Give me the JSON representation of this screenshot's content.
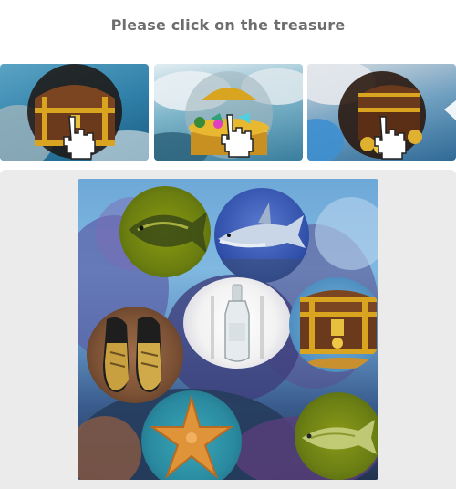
{
  "prompt": "Please click on the treasure",
  "examples": [
    {
      "subject": "treasure chest",
      "icon": "hand-pointer-icon"
    },
    {
      "subject": "treasure chest with gems",
      "icon": "hand-pointer-icon"
    },
    {
      "subject": "treasure chest with gold coins",
      "icon": "hand-pointer-icon"
    }
  ],
  "objects": [
    {
      "name": "fish-object",
      "subject": "green fish"
    },
    {
      "name": "shark-object",
      "subject": "shark"
    },
    {
      "name": "bottle-object",
      "subject": "glass bottle"
    },
    {
      "name": "treasure-chest-object",
      "subject": "treasure chest"
    },
    {
      "name": "shoes-object",
      "subject": "pair of shoes"
    },
    {
      "name": "starfish-object",
      "subject": "starfish"
    },
    {
      "name": "fish-object-2",
      "subject": "green fish"
    }
  ],
  "colors": {
    "prompt_text": "#6d6d6d",
    "play_area_bg": "#ebebeb",
    "chest_wood": "#6b3a1c",
    "chest_gold": "#d9a520"
  }
}
